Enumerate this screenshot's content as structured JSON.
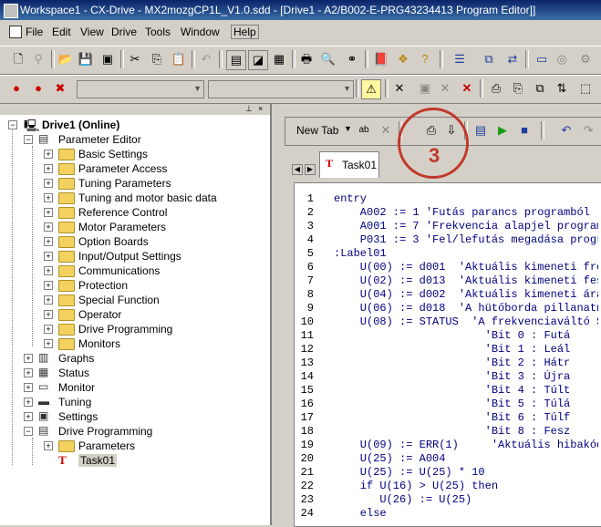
{
  "window": {
    "title": "Workspace1 - CX-Drive - MX2mozgCP1L_V1.0.sdd - [Drive1 - A2/B002-E-PRG43234413 Program Editor]]"
  },
  "menu": [
    {
      "label": "File"
    },
    {
      "label": "Edit"
    },
    {
      "label": "View"
    },
    {
      "label": "Drive"
    },
    {
      "label": "Tools"
    },
    {
      "label": "Window"
    },
    {
      "label": "Help"
    }
  ],
  "tree": {
    "root": "Drive1 (Online)",
    "items": [
      {
        "label": "Parameter Editor",
        "level": 1,
        "icon": "drive-icon"
      },
      {
        "label": "Basic Settings",
        "level": 2,
        "icon": "folder-icon"
      },
      {
        "label": "Parameter Access",
        "level": 2,
        "icon": "folder-icon"
      },
      {
        "label": "Tuning Parameters",
        "level": 2,
        "icon": "folder-icon"
      },
      {
        "label": "Tuning and motor basic data",
        "level": 2,
        "icon": "folder-icon"
      },
      {
        "label": "Reference Control",
        "level": 2,
        "icon": "folder-icon"
      },
      {
        "label": "Motor Parameters",
        "level": 2,
        "icon": "folder-icon"
      },
      {
        "label": "Option Boards",
        "level": 2,
        "icon": "folder-icon"
      },
      {
        "label": "Input/Output Settings",
        "level": 2,
        "icon": "folder-icon"
      },
      {
        "label": "Communications",
        "level": 2,
        "icon": "folder-icon"
      },
      {
        "label": "Protection",
        "level": 2,
        "icon": "folder-icon"
      },
      {
        "label": "Special Function",
        "level": 2,
        "icon": "folder-icon"
      },
      {
        "label": "Operator",
        "level": 2,
        "icon": "folder-icon"
      },
      {
        "label": "Drive Programming",
        "level": 2,
        "icon": "folder-icon"
      },
      {
        "label": "Monitors",
        "level": 2,
        "icon": "folder-icon"
      },
      {
        "label": "Graphs",
        "level": 1,
        "icon": "graph-icon"
      },
      {
        "label": "Status",
        "level": 1,
        "icon": "status-icon"
      },
      {
        "label": "Monitor",
        "level": 1,
        "icon": "monitor-icon"
      },
      {
        "label": "Tuning",
        "level": 1,
        "icon": "tuning-icon"
      },
      {
        "label": "Settings",
        "level": 1,
        "icon": "settings-icon"
      },
      {
        "label": "Drive Programming",
        "level": 1,
        "icon": "program-icon"
      },
      {
        "label": "Parameters",
        "level": 2,
        "icon": "folder-icon"
      },
      {
        "label": "Task01",
        "level": 2,
        "icon": "task-icon"
      }
    ]
  },
  "editor": {
    "new_tab_label": "New Tab",
    "tab_label": "Task01",
    "annotation_number": "3",
    "code": [
      {
        "n": "1",
        "text": "entry"
      },
      {
        "n": "2",
        "text": "    A002 := 1 'Futás parancs programból"
      },
      {
        "n": "3",
        "text": "    A001 := 7 'Frekvencia alapjel program"
      },
      {
        "n": "4",
        "text": "    P031 := 3 'Fel/lefutás megadása progr"
      },
      {
        "n": "5",
        "text": ":Label01"
      },
      {
        "n": "6",
        "text": "    U(00) := d001  'Aktuális kimeneti fre"
      },
      {
        "n": "7",
        "text": "    U(02) := d013  'Aktuális kimeneti fes"
      },
      {
        "n": "8",
        "text": "    U(04) := d002  'Aktuális kimeneti ára"
      },
      {
        "n": "9",
        "text": "    U(06) := d018  'A hütőborda pillanatn"
      },
      {
        "n": "10",
        "text": "    U(08) := STATUS  'A frekvenciaváltó S"
      },
      {
        "n": "11",
        "text": "                       'Bit 0 : Futá"
      },
      {
        "n": "12",
        "text": "                       'Bit 1 : Leál"
      },
      {
        "n": "13",
        "text": "                       'Bit 2 : Hátr"
      },
      {
        "n": "14",
        "text": "                       'Bit 3 : Újra"
      },
      {
        "n": "15",
        "text": "                       'Bit 4 : Túlt"
      },
      {
        "n": "16",
        "text": "                       'Bit 5 : Túlá"
      },
      {
        "n": "17",
        "text": "                       'Bit 6 : Túlf"
      },
      {
        "n": "18",
        "text": "                       'Bit 8 : Fesz"
      },
      {
        "n": "19",
        "text": "    U(09) := ERR(1)     'Aktuális hibakód"
      },
      {
        "n": "20",
        "text": "    U(25) := A004"
      },
      {
        "n": "21",
        "text": "    U(25) := U(25) * 10"
      },
      {
        "n": "22",
        "text": "    if U(16) > U(25) then"
      },
      {
        "n": "23",
        "text": "       U(26) := U(25)"
      },
      {
        "n": "24",
        "text": "    else"
      }
    ]
  },
  "colors": {
    "title_bar": "#0a246a",
    "annotation": "#c0392b",
    "keyword": "#0000c0"
  }
}
